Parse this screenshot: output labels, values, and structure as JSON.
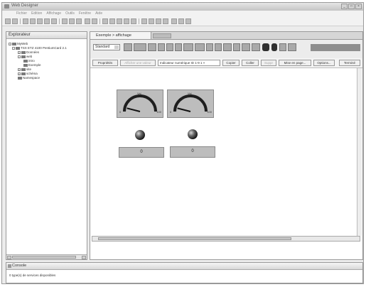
{
  "window": {
    "title": "Web Designer"
  },
  "menu": [
    "Fichier",
    "Edition",
    "Affichage",
    "Outils",
    "Fenêtre",
    "Aide"
  ],
  "explorer": {
    "title": "Explorateur",
    "tree": [
      "MyWeb",
      "TSX ETZ 4100 PentiumCard 2.1",
      "Données",
      "web",
      "intro",
      "Exemple",
      "site",
      "schéma",
      "Namespace"
    ]
  },
  "editor": {
    "tab_label": "Exemple > affichage",
    "palette_select": "Standard",
    "properties_bar": {
      "properties": "Propriétés",
      "display_value": "Afficher une valeur",
      "field": "Indicateur numérique ID 1-9 1 ×",
      "copy": "Copier",
      "paste": "Coller",
      "disabled": "Suppr",
      "layout": "Mise en page...",
      "options": "Options...",
      "finish": "Terminé"
    },
    "gauges": [
      {
        "top_label": "Val",
        "min_label": "0",
        "max_label": "100",
        "value_fraction": 0.08
      },
      {
        "top_label": "Val",
        "min_label": "0",
        "max_label": "100",
        "value_fraction": 0.08
      }
    ],
    "displays": [
      "0",
      "0"
    ]
  },
  "console": {
    "title": "Console",
    "message": "0 type(s) de services disponibles"
  }
}
